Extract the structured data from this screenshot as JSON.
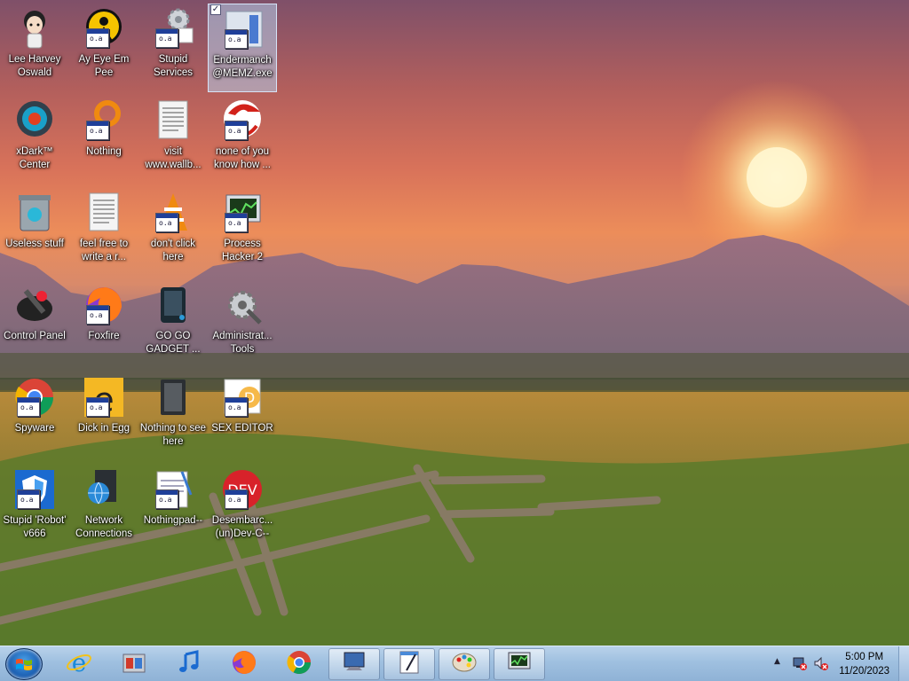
{
  "desktop": {
    "icons": [
      {
        "label": "Lee Harvey Oswald",
        "icon": "anime-character-icon"
      },
      {
        "label": "Ay Eye Em Pee",
        "icon": "aim-icon"
      },
      {
        "label": "Stupid Services",
        "icon": "services-gear-icon"
      },
      {
        "label": "Endermanch @MEMZ.exe",
        "icon": "exe-icon"
      },
      {
        "label": "xDark™ Center",
        "icon": "media-center-icon"
      },
      {
        "label": "Nothing",
        "icon": "orange-ring-icon"
      },
      {
        "label": "visit www.wallb...",
        "icon": "text-document-icon"
      },
      {
        "label": "none of you know how ...",
        "icon": "red-logo-icon"
      },
      {
        "label": "Useless stuff",
        "icon": "recycle-bin-icon"
      },
      {
        "label": "feel free to write a r...",
        "icon": "text-document-icon"
      },
      {
        "label": "don't click here",
        "icon": "vlc-cone-icon"
      },
      {
        "label": "Process Hacker 2",
        "icon": "process-monitor-icon"
      },
      {
        "label": "Control Panel",
        "icon": "control-panel-icon"
      },
      {
        "label": "Foxfire",
        "icon": "firefox-icon"
      },
      {
        "label": "GO GO GADGET ...",
        "icon": "gadget-icon"
      },
      {
        "label": "Administrat... Tools",
        "icon": "admin-tools-icon"
      },
      {
        "label": "Spyware",
        "icon": "chrome-icon"
      },
      {
        "label": "Dick in Egg",
        "icon": "edge-like-icon"
      },
      {
        "label": "Nothing to see here",
        "icon": "folder-icon"
      },
      {
        "label": "SEX EDITOR",
        "icon": "editor-icon"
      },
      {
        "label": "Stupid 'Robot' v666",
        "icon": "shield-icon"
      },
      {
        "label": "Network Connections",
        "icon": "network-globe-icon"
      },
      {
        "label": "Nothingpad--",
        "icon": "notepad-icon"
      },
      {
        "label": "Desembarc... (un)Dev-C--",
        "icon": "devcpp-icon"
      }
    ],
    "selected_icon": "Endermanch @MEMZ.exe"
  },
  "taskbar": {
    "start_icon": "windows-start-icon",
    "pinned": [
      {
        "name": "internet-explorer-icon"
      },
      {
        "name": "store-bag-icon"
      },
      {
        "name": "music-note-icon"
      },
      {
        "name": "firefox-icon"
      },
      {
        "name": "chrome-icon"
      },
      {
        "name": "monitor-app-icon"
      },
      {
        "name": "notepad-pen-icon"
      },
      {
        "name": "paint-palette-icon"
      },
      {
        "name": "process-monitor-icon"
      }
    ],
    "clock": {
      "time": "5:00 PM",
      "date": "11/20/2023"
    }
  },
  "colors": {
    "taskbar": "#a7c4e2",
    "sky_top": "#7f5069",
    "sun": "#fff4c8"
  }
}
